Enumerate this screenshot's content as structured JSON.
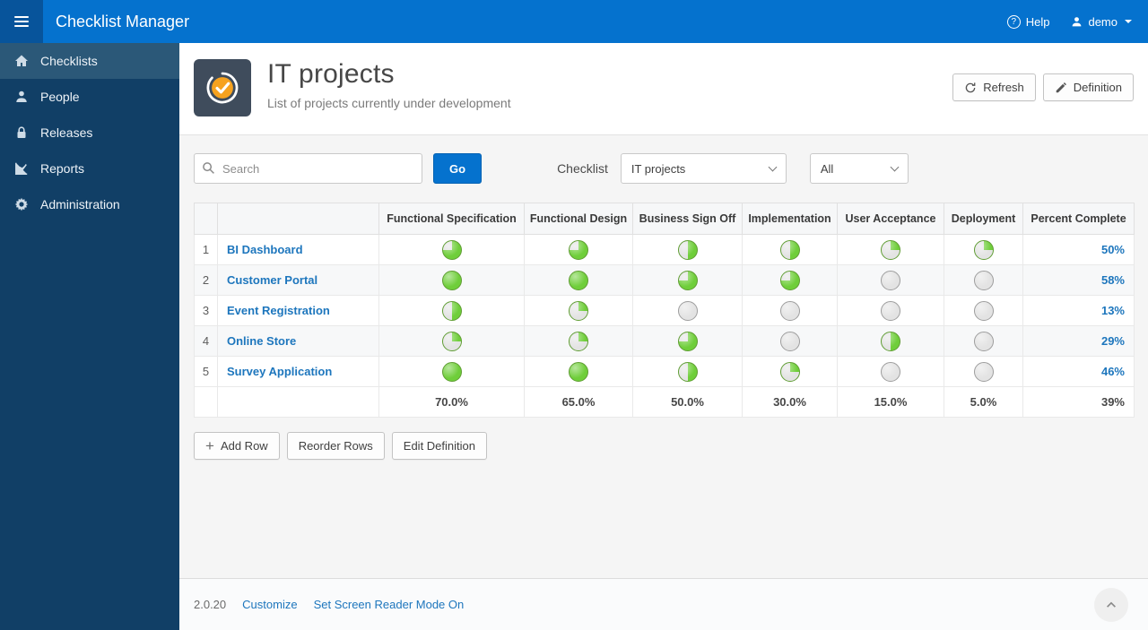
{
  "app": {
    "title": "Checklist Manager",
    "help_label": "Help",
    "user_label": "demo"
  },
  "sidebar": {
    "items": [
      {
        "label": "Checklists",
        "icon": "checklists",
        "active": true
      },
      {
        "label": "People",
        "icon": "people",
        "active": false
      },
      {
        "label": "Releases",
        "icon": "releases",
        "active": false
      },
      {
        "label": "Reports",
        "icon": "reports",
        "active": false
      },
      {
        "label": "Administration",
        "icon": "administration",
        "active": false
      }
    ]
  },
  "page": {
    "title": "IT projects",
    "subtitle": "List of projects currently under development",
    "buttons": {
      "refresh": "Refresh",
      "definition": "Definition"
    }
  },
  "toolbar": {
    "search_placeholder": "Search",
    "go": "Go",
    "checklist_label": "Checklist",
    "checklist_selected": "IT projects",
    "scope_selected": "All"
  },
  "table": {
    "stage_columns": [
      "Functional Specification",
      "Functional Design",
      "Business Sign Off",
      "Implementation",
      "User Acceptance",
      "Deployment"
    ],
    "percent_column": "Percent Complete",
    "rows": [
      {
        "num": "1",
        "name": "BI Dashboard",
        "stages": [
          75,
          75,
          50,
          50,
          25,
          25
        ],
        "percent": "50%"
      },
      {
        "num": "2",
        "name": "Customer Portal",
        "stages": [
          100,
          100,
          75,
          75,
          0,
          0
        ],
        "percent": "58%"
      },
      {
        "num": "3",
        "name": "Event Registration",
        "stages": [
          50,
          25,
          0,
          0,
          0,
          0
        ],
        "percent": "13%"
      },
      {
        "num": "4",
        "name": "Online Store",
        "stages": [
          25,
          25,
          75,
          0,
          50,
          0
        ],
        "percent": "29%"
      },
      {
        "num": "5",
        "name": "Survey Application",
        "stages": [
          100,
          100,
          50,
          25,
          0,
          0
        ],
        "percent": "46%"
      }
    ],
    "totals": {
      "stages": [
        "70.0%",
        "65.0%",
        "50.0%",
        "30.0%",
        "15.0%",
        "5.0%"
      ],
      "percent": "39%"
    }
  },
  "actions": {
    "add_row": "Add Row",
    "reorder_rows": "Reorder Rows",
    "edit_definition": "Edit Definition"
  },
  "footer": {
    "version": "2.0.20",
    "customize": "Customize",
    "screen_reader": "Set Screen Reader Mode On"
  },
  "colors": {
    "header": "#0572ce",
    "accent": "#0572ce",
    "pie_filled": "#6fce3a",
    "pie_empty": "#e3e3e3",
    "link": "#1d76bd",
    "sidebar": "#113f66"
  }
}
